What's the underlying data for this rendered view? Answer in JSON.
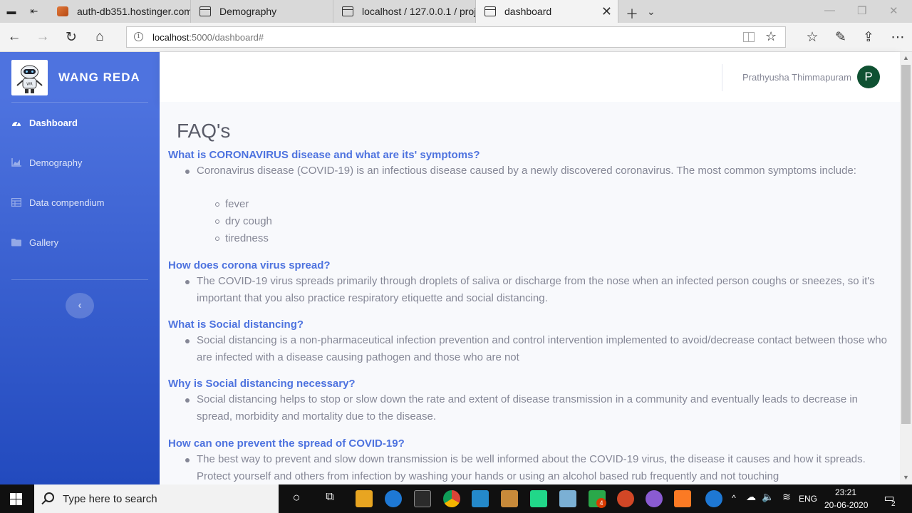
{
  "browser": {
    "tabs": [
      {
        "title": "auth-db351.hostinger.com /",
        "active": false
      },
      {
        "title": "Demography",
        "active": false
      },
      {
        "title": "localhost / 127.0.0.1 / proje",
        "active": false
      },
      {
        "title": "dashboard",
        "active": true
      }
    ],
    "url_host": "localhost",
    "url_rest": ":5000/dashboard#"
  },
  "sidebar": {
    "brand": "WANG REDA",
    "items": [
      {
        "label": "Dashboard",
        "icon": "tachometer-icon",
        "active": true
      },
      {
        "label": "Demography",
        "icon": "chart-area-icon",
        "active": false
      },
      {
        "label": "Data compendium",
        "icon": "table-icon",
        "active": false
      },
      {
        "label": "Gallery",
        "icon": "folder-icon",
        "active": false
      }
    ],
    "toggle_icon": "chevron-left-icon",
    "toggle_glyph": "‹"
  },
  "topbar": {
    "user_name": "Prathyusha Thimmapuram",
    "avatar_initial": "P"
  },
  "main": {
    "title": "FAQ's",
    "faqs": [
      {
        "question": "What is CORONAVIRUS disease and what are its' symptoms?",
        "answer": "Coronavirus disease (COVID-19) is an infectious disease caused by a newly discovered coronavirus. The most common symptoms include:",
        "sub_items": [
          "fever",
          "dry cough",
          "tiredness"
        ]
      },
      {
        "question": "How does corona virus spread?",
        "answer": "The COVID-19 virus spreads primarily through droplets of saliva or discharge from the nose when an infected person coughs or sneezes, so it's important that you also practice respiratory etiquette and social distancing."
      },
      {
        "question": "What is Social distancing?",
        "answer": "Social distancing is a non-pharmaceutical infection prevention and control intervention implemented to avoid/decrease contact between those who are infected with a disease causing pathogen and those who are not"
      },
      {
        "question": "Why is Social distancing necessary?",
        "answer": "Social distancing helps to stop or slow down the rate and extent of disease transmission in a community and eventually leads to decrease in spread, morbidity and mortality due to the disease."
      },
      {
        "question": "How can one prevent the spread of COVID-19?",
        "answer": "The best way to prevent and slow down transmission is be well informed about the COVID-19 virus, the disease it causes and how it spreads. Protect yourself and others from infection by washing your hands or using an alcohol based rub frequently and not touching"
      }
    ]
  },
  "taskbar": {
    "search_placeholder": "Type here to search",
    "language": "ENG",
    "time": "23:21",
    "date": "20-06-2020",
    "mail_badge": "4",
    "notification_count": "2"
  },
  "colors": {
    "sidebar_top": "#4e73df",
    "sidebar_bottom": "#224abe",
    "question": "#4e73df",
    "answer_text": "#858796",
    "avatar": "#0f5132"
  }
}
